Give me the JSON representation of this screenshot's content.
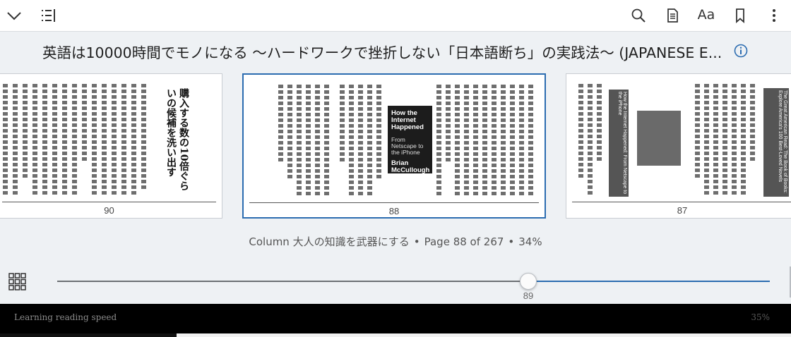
{
  "header": {
    "icons": [
      "chevron-down-icon",
      "toc-icon",
      "search-icon",
      "notebook-icon",
      "font-icon",
      "bookmark-icon",
      "more-icon"
    ],
    "font_label": "Aa"
  },
  "book": {
    "title": "英語は10000時間でモノになる ～ハードワークで挫折しない「日本語断ち」の実践法～ (JAPANESE E..."
  },
  "pages": [
    {
      "number": "90",
      "heading": "購入する数の10倍ぐらいの候補を洗い出す"
    },
    {
      "number": "88",
      "cover": {
        "title": "How the Internet Happened",
        "subtitle": "From Netscape to the iPhone",
        "author": "Brian McCullough"
      }
    },
    {
      "number": "87",
      "banner_left": "The Great American Read: The Book of Books: Explore America's 100 Best-Loved Novels",
      "banner_right": "How the Internet Happened: From Netscape to the iPhone"
    }
  ],
  "status": {
    "chapter": "Column 大人の知識を武器にする",
    "page_info": "Page 88 of 267",
    "percent": "34%"
  },
  "slider": {
    "label": "89",
    "value_fraction": 0.65
  },
  "footer": {
    "left": "Learning reading speed",
    "right": "35%"
  },
  "colors": {
    "accent": "#2b6cb0",
    "background": "#eef1f4"
  }
}
